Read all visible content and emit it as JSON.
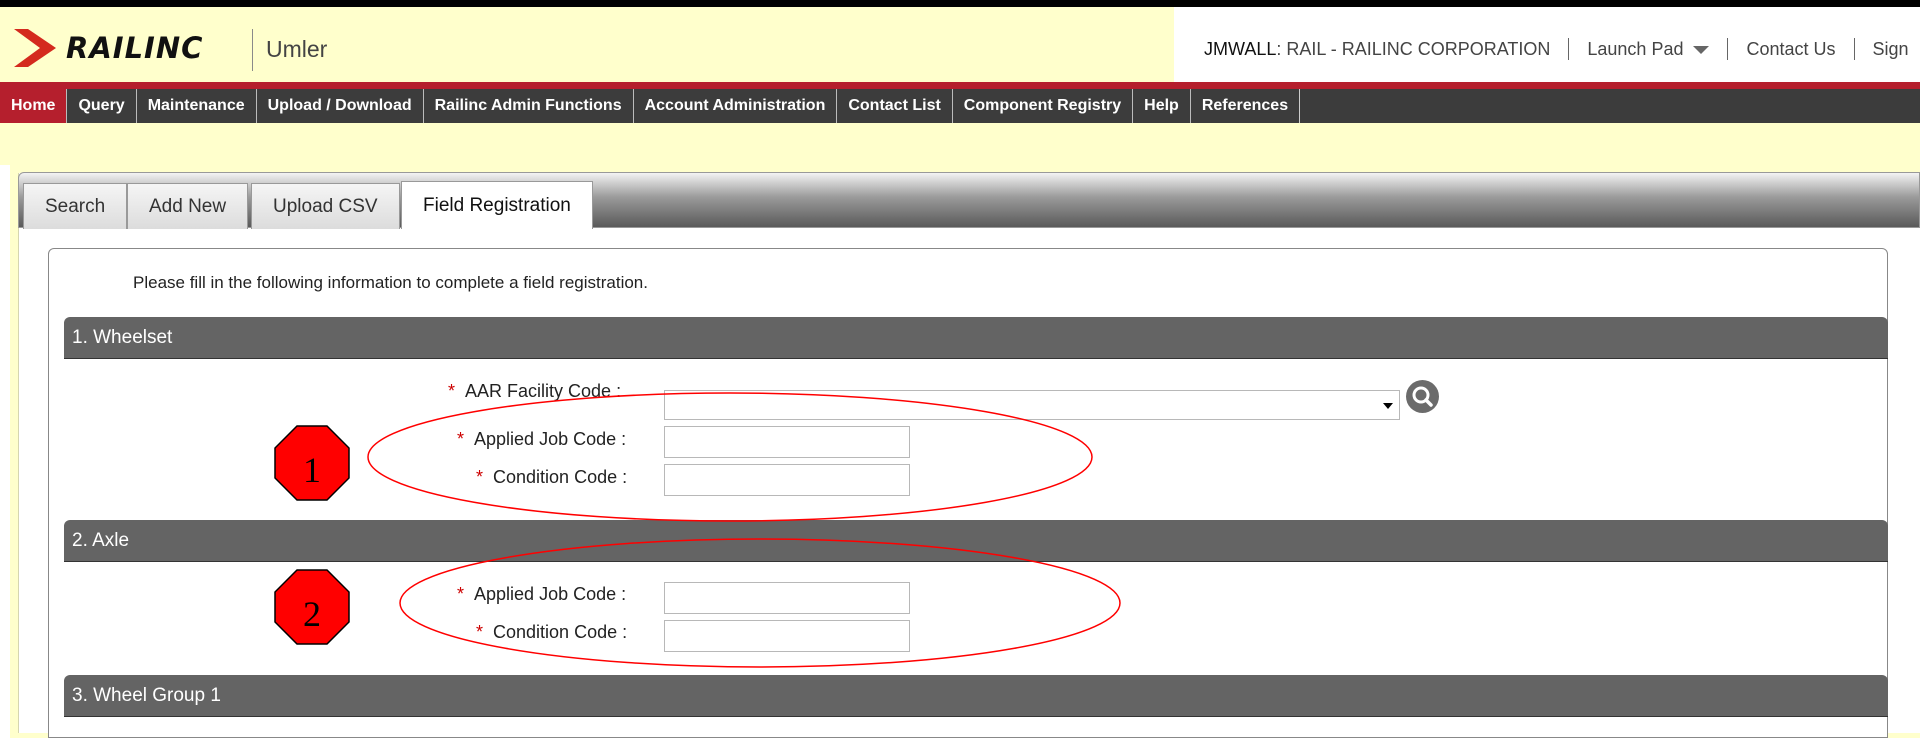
{
  "header": {
    "brand": "RAILINC",
    "app_name": "Umler",
    "user_id": "JMWALL",
    "user_org": " : RAIL - RAILINC CORPORATION",
    "launch_pad": "Launch Pad",
    "contact_us": "Contact Us",
    "sign_out": "Sign"
  },
  "menu": [
    {
      "label": "Home"
    },
    {
      "label": "Query"
    },
    {
      "label": "Maintenance"
    },
    {
      "label": "Upload / Download"
    },
    {
      "label": "Railinc Admin Functions"
    },
    {
      "label": "Account Administration"
    },
    {
      "label": "Contact List"
    },
    {
      "label": "Component Registry"
    },
    {
      "label": "Help"
    },
    {
      "label": "References"
    }
  ],
  "tabs": [
    {
      "label": "Search"
    },
    {
      "label": "Add New"
    },
    {
      "label": "Upload CSV"
    },
    {
      "label": "Field Registration"
    }
  ],
  "intro": "Please fill in the following information to complete a field registration.",
  "sections": {
    "wheelset": {
      "title": "1. Wheelset",
      "aar_label": "AAR Facility Code :",
      "aar_value": "",
      "job_label": "Applied Job Code :",
      "job_value": "",
      "cond_label": "Condition Code :",
      "cond_value": ""
    },
    "axle": {
      "title": "2. Axle",
      "job_label": "Applied Job Code :",
      "job_value": "",
      "cond_label": "Condition Code :",
      "cond_value": ""
    },
    "wheel_group": {
      "title": "3. Wheel Group 1"
    }
  },
  "required_mark": "*",
  "callouts": [
    "1",
    "2"
  ],
  "colors": {
    "brand_red": "#b51f2d",
    "header_yellow": "#ffffcc",
    "menu_dark": "#3c3c3c",
    "section_gray": "#646464",
    "callout_red": "#ff0000"
  }
}
